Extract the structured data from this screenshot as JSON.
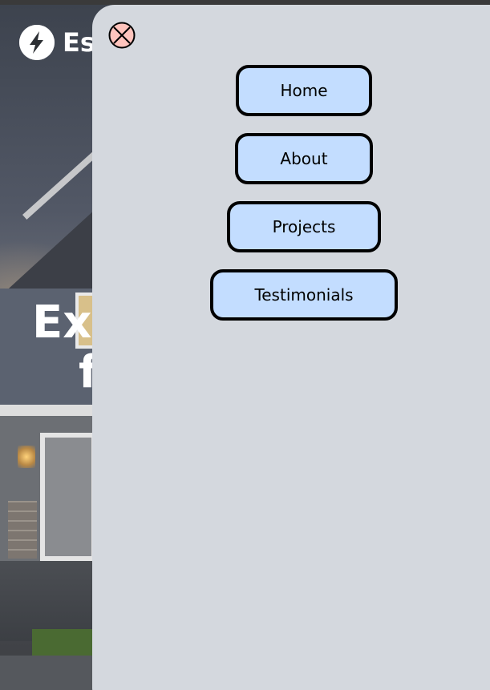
{
  "brand": {
    "name": "Es",
    "logo_icon": "lightning-bolt-icon"
  },
  "hero": {
    "title_line1": "Ex",
    "title_line2": "f"
  },
  "menu": {
    "close_icon": "close-x-circle-icon",
    "items": [
      {
        "label": "Home"
      },
      {
        "label": "About"
      },
      {
        "label": "Projects"
      },
      {
        "label": "Testimonials"
      }
    ]
  },
  "colors": {
    "panel_background": "#d4d8de",
    "nav_button_fill": "#c3ddff",
    "nav_button_border": "#000000",
    "close_icon_fill": "#ffc4bd"
  }
}
